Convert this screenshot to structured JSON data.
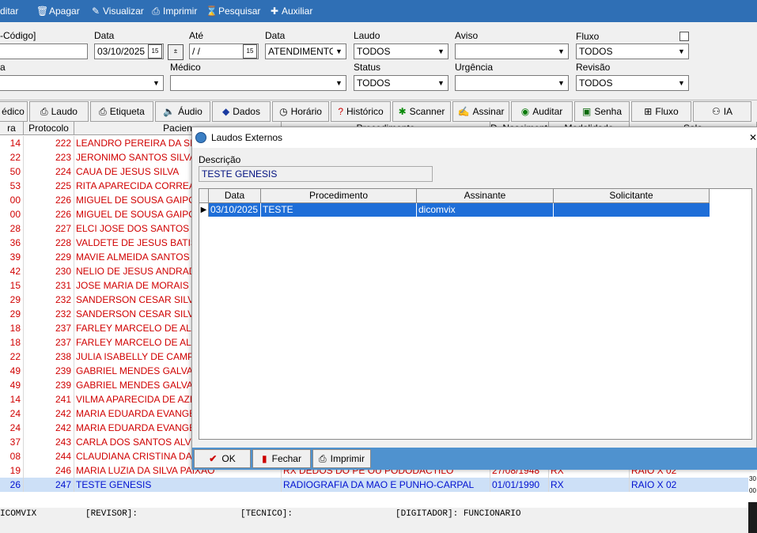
{
  "toolbar": {
    "items": [
      "ditar",
      "Apagar",
      "Visualizar",
      "Imprimir",
      "Pesquisar",
      "Auxiliar"
    ]
  },
  "filters": {
    "codigo_label": "-Código]",
    "codigo_value": "",
    "data_label": "Data",
    "data_value": "03/10/2025",
    "ate_label": "Até",
    "ate_value": " / /",
    "data2_label": "Data",
    "data2_value": "ATENDIMENTO",
    "laudo_label": "Laudo",
    "laudo_value": "TODOS",
    "aviso_label": "Aviso",
    "aviso_value": "",
    "fluxo_label": "Fluxo",
    "fluxo_value": "TODOS",
    "a_label": "a",
    "a_value": "",
    "medico_label": "Médico",
    "medico_value": "",
    "status_label": "Status",
    "status_value": "TODOS",
    "urgencia_label": "Urgência",
    "urgencia_value": "",
    "revisao_label": "Revisão",
    "revisao_value": "TODOS"
  },
  "buttons": {
    "items": [
      "édico",
      "Laudo",
      "Etiqueta",
      "Áudio",
      "Dados",
      "Horário",
      "Histórico",
      "Scanner",
      "Assinar",
      "Auditar",
      "Senha",
      "Fluxo",
      "IA"
    ]
  },
  "grid": {
    "headers": [
      "ra",
      "Protocolo",
      "Pacien",
      "Procedimento",
      "D. Nascimento",
      "Modalidade",
      "Sala"
    ],
    "rows": [
      [
        "14",
        "222",
        "LEANDRO PEREIRA DA SILVA",
        "",
        "",
        "",
        ""
      ],
      [
        "22",
        "223",
        "JERONIMO SANTOS SILVA",
        "",
        "",
        "",
        ""
      ],
      [
        "50",
        "224",
        "CAUA DE JESUS SILVA",
        "",
        "",
        "",
        ""
      ],
      [
        "53",
        "225",
        "RITA APARECIDA CORREA C",
        "",
        "",
        "",
        ""
      ],
      [
        "00",
        "226",
        "MIGUEL DE SOUSA GAIPO",
        "",
        "",
        "",
        ""
      ],
      [
        "00",
        "226",
        "MIGUEL DE SOUSA GAIPO",
        "",
        "",
        "",
        ""
      ],
      [
        "28",
        "227",
        "ELCI JOSE DOS SANTOS",
        "",
        "",
        "",
        ""
      ],
      [
        "36",
        "228",
        "VALDETE DE JESUS BATIST",
        "",
        "",
        "",
        ""
      ],
      [
        "39",
        "229",
        "MAVIE ALMEIDA SANTOS",
        "",
        "",
        "",
        ""
      ],
      [
        "42",
        "230",
        "NELIO DE JESUS ANDRADE",
        "",
        "",
        "",
        ""
      ],
      [
        "15",
        "231",
        "JOSE MARIA DE MORAIS",
        "",
        "",
        "",
        ""
      ],
      [
        "29",
        "232",
        "SANDERSON CESAR SILVEII",
        "",
        "",
        "",
        ""
      ],
      [
        "29",
        "232",
        "SANDERSON CESAR SILVEII",
        "",
        "",
        "",
        ""
      ],
      [
        "18",
        "237",
        "FARLEY MARCELO DE ALME",
        "",
        "",
        "",
        ""
      ],
      [
        "18",
        "237",
        "FARLEY MARCELO DE ALME",
        "",
        "",
        "",
        ""
      ],
      [
        "22",
        "238",
        "JULIA ISABELLY DE CAMPOS",
        "",
        "",
        "",
        ""
      ],
      [
        "49",
        "239",
        "GABRIEL MENDES GALVAO",
        "",
        "",
        "",
        ""
      ],
      [
        "49",
        "239",
        "GABRIEL MENDES GALVAO",
        "",
        "",
        "",
        ""
      ],
      [
        "14",
        "241",
        "VILMA APARECIDA DE AZEV",
        "",
        "",
        "",
        ""
      ],
      [
        "24",
        "242",
        "MARIA EDUARDA EVANGELI",
        "",
        "",
        "",
        ""
      ],
      [
        "24",
        "242",
        "MARIA EDUARDA EVANGELI",
        "",
        "",
        "",
        ""
      ],
      [
        "37",
        "243",
        "CARLA DOS SANTOS ALVES",
        "",
        "",
        "",
        ""
      ],
      [
        "08",
        "244",
        "CLAUDIANA CRISTINA DA SI",
        "",
        "",
        "",
        ""
      ],
      [
        "19",
        "246",
        "MARIA LUZIA DA SILVA PAIXAO",
        "RX DEDOS DO PE OU PODODACTILO",
        "27/08/1948",
        "RX",
        "RAIO X 02"
      ],
      [
        "26",
        "247",
        "TESTE GENESIS",
        "RADIOGRAFIA DA MAO E PUNHO-CARPAL",
        "01/01/1990",
        "RX",
        "RAIO X 02"
      ]
    ]
  },
  "status": {
    "part1": "ICOMVIX",
    "part2": "[REVISOR]:",
    "part3": "[TECNICO]:",
    "part4": "[DIGITADOR]: FUNCIONARIO"
  },
  "dialog": {
    "title": "Laudos Externos",
    "close": "✕",
    "desc_label": "Descrição",
    "desc_value": "TESTE GENESIS",
    "headers": [
      "Data",
      "Procedimento",
      "Assinante",
      "Solicitante"
    ],
    "row": [
      "03/10/2025",
      "TESTE",
      "dicomvix",
      ""
    ],
    "ok_label": "OK",
    "fechar_label": "Fechar",
    "imprimir_label": "Imprimir"
  },
  "right_panel": {
    "t1": "30",
    "t2": "00"
  }
}
